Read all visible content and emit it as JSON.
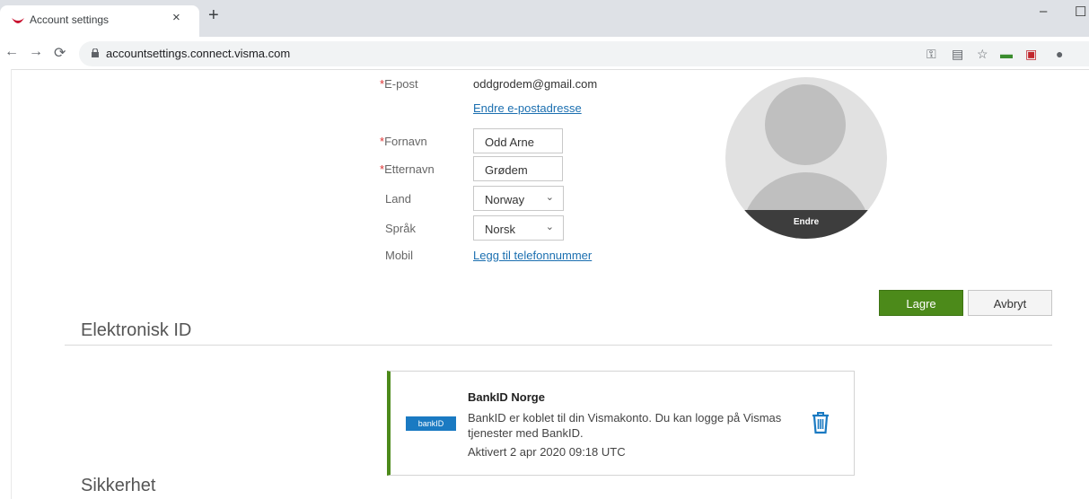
{
  "browser": {
    "tab_title": "Account settings",
    "tab_close": "×",
    "new_tab": "+",
    "url": "accountsettings.connect.visma.com",
    "minimize": "–",
    "maximize": "☐"
  },
  "form": {
    "email_label": "E-post",
    "email_value": "oddgrodem@gmail.com",
    "change_email_link": "Endre e-postadresse",
    "firstname_label": "Fornavn",
    "firstname_value": "Odd Arne",
    "lastname_label": "Etternavn",
    "lastname_value": "Grødem",
    "country_label": "Land",
    "country_value": "Norway",
    "language_label": "Språk",
    "language_value": "Norsk",
    "mobile_label": "Mobil",
    "add_phone_link": "Legg til telefonnummer",
    "required_marker": "*"
  },
  "avatar": {
    "edit_label": "Endre"
  },
  "actions": {
    "save": "Lagre",
    "cancel": "Avbryt"
  },
  "eid": {
    "title": "Elektronisk ID",
    "provider_logo_text": "bankID",
    "card_title": "BankID Norge",
    "card_description": "BankID er koblet til din Vismakonto. Du kan logge på Vismas tjenester med BankID.",
    "card_activated": "Aktivert 2 apr 2020 09:18 UTC"
  },
  "security": {
    "title": "Sikkerhet"
  },
  "colors": {
    "accent_green": "#4c8a1a",
    "link_blue": "#1b6fb0",
    "bankid_blue": "#1a7ac2"
  }
}
